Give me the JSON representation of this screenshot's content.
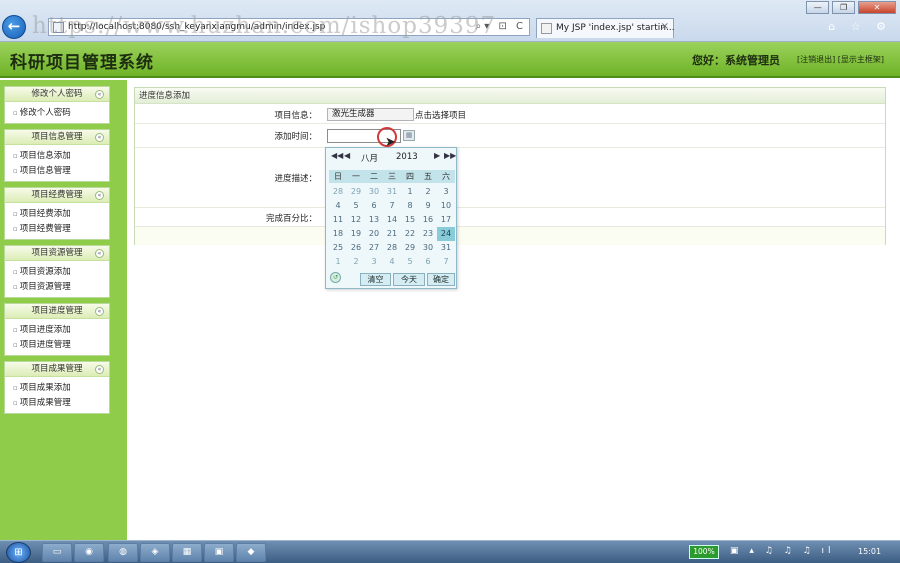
{
  "browser": {
    "back_symbol": "←",
    "address_url": "http://localhost:8080/ssh_keyanxiangmu/admin/index.jsp",
    "address_tools": "⌕▾ ⊡ C",
    "tab_title": "My JSP 'index.jsp' startin...",
    "tab_close": "×",
    "minimize": "—",
    "restore": "❐",
    "close": "✕",
    "chrome_icons": "⌂ ☆ ⚙",
    "watermark": "https://www.huzhan.com/ishop39397"
  },
  "header": {
    "app_title": "科研项目管理系统",
    "greeting": "您好：系统管理员",
    "links": "[注销退出] [显示主框架]"
  },
  "sidebar": {
    "toggle_symbol": "«",
    "groups": [
      {
        "title": "修改个人密码",
        "items": [
          "修改个人密码"
        ]
      },
      {
        "title": "项目信息管理",
        "items": [
          "项目信息添加",
          "项目信息管理"
        ]
      },
      {
        "title": "项目经费管理",
        "items": [
          "项目经费添加",
          "项目经费管理"
        ]
      },
      {
        "title": "项目资源管理",
        "items": [
          "项目资源添加",
          "项目资源管理"
        ]
      },
      {
        "title": "项目进度管理",
        "items": [
          "项目进度添加",
          "项目进度管理"
        ]
      },
      {
        "title": "项目成果管理",
        "items": [
          "项目成果添加",
          "项目成果管理"
        ]
      }
    ]
  },
  "form": {
    "section_title": "进度信息添加",
    "project_label": "项目信息：",
    "project_value": "激光生成器",
    "project_select_link": "点击选择项目",
    "time_label": "添加时间：",
    "time_value": "",
    "calendar_icon": "▦",
    "desc_label": "进度描述：",
    "percent_label": "完成百分比："
  },
  "datepicker": {
    "prev_year": "◀◀",
    "prev_month": "◀",
    "month": "八月",
    "year": "2013",
    "next_month": "▶",
    "next_year": "▶▶",
    "weekdays": [
      "日",
      "一",
      "二",
      "三",
      "四",
      "五",
      "六"
    ],
    "days": [
      "28",
      "29",
      "30",
      "31",
      "1",
      "2",
      "3",
      "4",
      "5",
      "6",
      "7",
      "8",
      "9",
      "10",
      "11",
      "12",
      "13",
      "14",
      "15",
      "16",
      "17",
      "18",
      "19",
      "20",
      "21",
      "22",
      "23",
      "24",
      "25",
      "26",
      "27",
      "28",
      "29",
      "30",
      "31",
      "1",
      "2",
      "3",
      "4",
      "5",
      "6",
      "7"
    ],
    "selected_day": "24",
    "footer_icon": "↺",
    "clear": "清空",
    "today": "今天",
    "confirm": "确定"
  },
  "taskbar": {
    "start_symbol": "⊞",
    "apps": [
      "▭",
      "◉",
      "◍",
      "◈",
      "▦",
      "▣",
      "◆"
    ],
    "battery": "100%",
    "tray": "▣ ▴ ♫ ♫ ♫ ıl",
    "clock": "15:01"
  },
  "colors": {
    "header_green": "#6fb327",
    "sidebar_green": "#8fcc4a",
    "calendar_selected": "#89ccd9",
    "taskbar_blue": "#3c5d82"
  }
}
